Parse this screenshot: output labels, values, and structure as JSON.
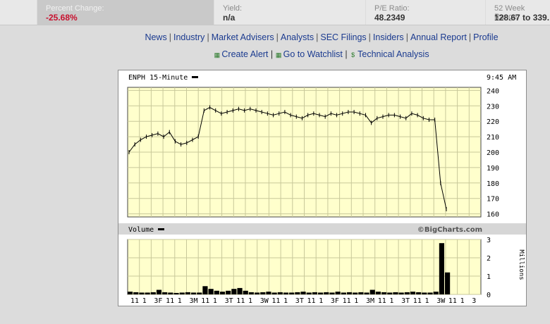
{
  "stats": [
    {
      "label": "",
      "value": ""
    },
    {
      "label": "Percent Change:",
      "value": "-25.68%"
    },
    {
      "label": "Yield:",
      "value": "n/a"
    },
    {
      "label": "P/E Ratio:",
      "value": "48.2349"
    },
    {
      "label": "52 Week Range:",
      "value": "128.67 to 339."
    }
  ],
  "nav_links": [
    "News",
    "Industry",
    "Market Advisers",
    "Analysts",
    "SEC Filings",
    "Insiders",
    "Annual Report",
    "Profile"
  ],
  "tool_links": [
    {
      "icon": "calculator-icon",
      "label": "Create Alert"
    },
    {
      "icon": "calculator-icon",
      "label": "Go to Watchlist"
    },
    {
      "icon": "dollar-icon",
      "label": "Technical Analysis"
    }
  ],
  "chart_header": {
    "symbol_label": "ENPH 15-Minute",
    "time": "9:45 AM"
  },
  "volume_header": {
    "label": "Volume",
    "brand": "©BigCharts.com",
    "units": "Millions"
  },
  "chart_data": [
    {
      "type": "line",
      "title": "ENPH 15-Minute",
      "y_ticks": [
        "240",
        "230",
        "220",
        "210",
        "200",
        "190",
        "180",
        "170",
        "160"
      ],
      "ylim": [
        158,
        242
      ],
      "x": [
        "11",
        "1",
        "3F",
        "11",
        "1",
        "3M",
        "11",
        "1",
        "3T",
        "11",
        "1",
        "3W",
        "11",
        "1",
        "3T",
        "11",
        "1",
        "3F",
        "11",
        "1",
        "3M",
        "11",
        "1",
        "3T",
        "11",
        "1",
        "3W",
        "11",
        "1",
        "3"
      ],
      "series": [
        {
          "values": [
            200,
            205,
            208,
            210,
            211,
            212,
            210,
            213,
            207,
            205,
            206,
            208,
            210,
            227,
            229,
            227,
            225,
            226,
            227,
            228,
            227,
            228,
            227,
            226,
            225,
            224,
            225,
            226,
            224,
            223,
            222,
            224,
            225,
            224,
            223,
            225,
            224,
            225,
            226,
            226,
            225,
            224,
            219,
            222,
            223,
            224,
            224,
            223,
            222,
            225,
            224,
            222,
            221,
            221,
            180,
            163
          ]
        }
      ],
      "grid": true
    },
    {
      "type": "bar",
      "title": "Volume",
      "ylabel": "Millions",
      "y_ticks": [
        "3",
        "2",
        "1",
        "0"
      ],
      "ylim": [
        0,
        3
      ],
      "values": [
        0.15,
        0.12,
        0.1,
        0.1,
        0.12,
        0.25,
        0.12,
        0.1,
        0.08,
        0.1,
        0.12,
        0.1,
        0.1,
        0.45,
        0.3,
        0.2,
        0.15,
        0.2,
        0.3,
        0.35,
        0.2,
        0.12,
        0.1,
        0.12,
        0.15,
        0.1,
        0.12,
        0.1,
        0.1,
        0.12,
        0.15,
        0.1,
        0.12,
        0.1,
        0.12,
        0.1,
        0.15,
        0.1,
        0.12,
        0.1,
        0.12,
        0.1,
        0.25,
        0.15,
        0.12,
        0.1,
        0.12,
        0.1,
        0.12,
        0.15,
        0.12,
        0.1,
        0.1,
        0.15,
        2.8,
        1.2
      ]
    }
  ],
  "x_axis_labels": [
    "11",
    "1",
    "3F",
    "11",
    "1",
    "3M",
    "11",
    "1",
    "3T",
    "11",
    "1",
    "3W",
    "11",
    "1",
    "3T",
    "11",
    "1",
    "3F",
    "11",
    "1",
    "3M",
    "11",
    "1",
    "3T",
    "11",
    "1",
    "3W",
    "11",
    "1",
    "3"
  ]
}
